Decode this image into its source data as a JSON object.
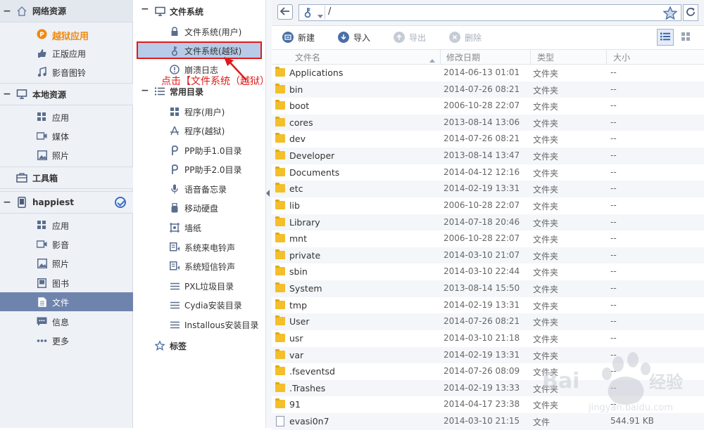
{
  "sidebar": {
    "sections": [
      {
        "label": "网络资源",
        "items": [
          {
            "label": "越狱应用",
            "icon": "jailbreak-icon"
          },
          {
            "label": "正版应用",
            "icon": "thumbs-up-icon"
          },
          {
            "label": "影音图铃",
            "icon": "music-icon"
          }
        ]
      },
      {
        "label": "本地资源",
        "items": [
          {
            "label": "应用",
            "icon": "apps-icon"
          },
          {
            "label": "媒体",
            "icon": "video-icon"
          },
          {
            "label": "照片",
            "icon": "photo-icon"
          }
        ]
      },
      {
        "label": "工具箱",
        "items": []
      },
      {
        "label": "happiest",
        "items": [
          {
            "label": "应用",
            "icon": "apps-icon"
          },
          {
            "label": "影音",
            "icon": "video-icon"
          },
          {
            "label": "照片",
            "icon": "photo-icon"
          },
          {
            "label": "图书",
            "icon": "book-icon"
          },
          {
            "label": "文件",
            "icon": "file-icon"
          },
          {
            "label": "信息",
            "icon": "message-icon"
          },
          {
            "label": "更多",
            "icon": "more-icon"
          }
        ]
      }
    ]
  },
  "tree": {
    "filesystem_label": "文件系统",
    "filesystem_items": [
      "文件系统(用户)",
      "文件系统(越狱)",
      "崩溃日志"
    ],
    "common_label": "常用目录",
    "common_items": [
      "程序(用户)",
      "程序(越狱)",
      "PP助手1.0目录",
      "PP助手2.0目录",
      "语音备忘录",
      "移动硬盘",
      "墙纸",
      "系统来电铃声",
      "系统短信铃声",
      "PXL垃圾目录",
      "Cydia安装目录",
      "Installous安装目录"
    ],
    "tags_label": "标签"
  },
  "annotation": "点击【文件系统（越狱）】",
  "address": {
    "path": "/"
  },
  "toolbar": {
    "new": "新建",
    "import": "导入",
    "export": "导出",
    "delete": "删除"
  },
  "columns": {
    "name": "文件名",
    "date": "修改日期",
    "type": "类型",
    "size": "大小"
  },
  "files": [
    {
      "name": "Applications",
      "date": "2014-06-13 01:01",
      "type": "文件夹",
      "size": "--",
      "kind": "folder"
    },
    {
      "name": "bin",
      "date": "2014-07-26 08:21",
      "type": "文件夹",
      "size": "--",
      "kind": "folder"
    },
    {
      "name": "boot",
      "date": "2006-10-28 22:07",
      "type": "文件夹",
      "size": "--",
      "kind": "folder"
    },
    {
      "name": "cores",
      "date": "2013-08-14 13:06",
      "type": "文件夹",
      "size": "--",
      "kind": "folder"
    },
    {
      "name": "dev",
      "date": "2014-07-26 08:21",
      "type": "文件夹",
      "size": "--",
      "kind": "folder"
    },
    {
      "name": "Developer",
      "date": "2013-08-14 13:47",
      "type": "文件夹",
      "size": "--",
      "kind": "folder"
    },
    {
      "name": "Documents",
      "date": "2014-04-12 12:16",
      "type": "文件夹",
      "size": "--",
      "kind": "folder"
    },
    {
      "name": "etc",
      "date": "2014-02-19 13:31",
      "type": "文件夹",
      "size": "--",
      "kind": "folder"
    },
    {
      "name": "lib",
      "date": "2006-10-28 22:07",
      "type": "文件夹",
      "size": "--",
      "kind": "folder"
    },
    {
      "name": "Library",
      "date": "2014-07-18 20:46",
      "type": "文件夹",
      "size": "--",
      "kind": "folder"
    },
    {
      "name": "mnt",
      "date": "2006-10-28 22:07",
      "type": "文件夹",
      "size": "--",
      "kind": "folder"
    },
    {
      "name": "private",
      "date": "2014-03-10 21:07",
      "type": "文件夹",
      "size": "--",
      "kind": "folder"
    },
    {
      "name": "sbin",
      "date": "2014-03-10 22:44",
      "type": "文件夹",
      "size": "--",
      "kind": "folder"
    },
    {
      "name": "System",
      "date": "2013-08-14 15:50",
      "type": "文件夹",
      "size": "--",
      "kind": "folder"
    },
    {
      "name": "tmp",
      "date": "2014-02-19 13:31",
      "type": "文件夹",
      "size": "--",
      "kind": "folder"
    },
    {
      "name": "User",
      "date": "2014-07-26 08:21",
      "type": "文件夹",
      "size": "--",
      "kind": "folder"
    },
    {
      "name": "usr",
      "date": "2014-03-10 21:18",
      "type": "文件夹",
      "size": "--",
      "kind": "folder"
    },
    {
      "name": "var",
      "date": "2014-02-19 13:31",
      "type": "文件夹",
      "size": "--",
      "kind": "folder"
    },
    {
      "name": ".fseventsd",
      "date": "2014-07-26 08:09",
      "type": "文件夹",
      "size": "--",
      "kind": "folder"
    },
    {
      "name": ".Trashes",
      "date": "2014-02-19 13:33",
      "type": "文件夹",
      "size": "--",
      "kind": "folder"
    },
    {
      "name": "91",
      "date": "2014-04-17 23:38",
      "type": "文件夹",
      "size": "--",
      "kind": "folder"
    },
    {
      "name": "evasi0n7",
      "date": "2014-03-10 21:15",
      "type": "文件",
      "size": "544.91 KB",
      "kind": "file"
    }
  ],
  "colors": {
    "accent": "#6f84ad",
    "highlight_border": "#e01a1a",
    "jailbreak_orange": "#f08a10",
    "folder": "#f3bf2a"
  }
}
